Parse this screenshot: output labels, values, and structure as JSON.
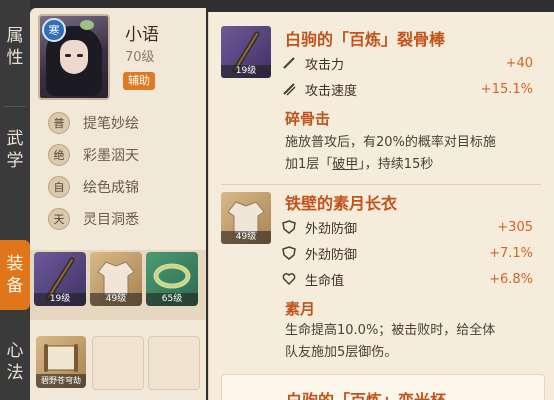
{
  "side_tabs": [
    {
      "chars": [
        "属",
        "性"
      ],
      "active": false
    },
    {
      "chars": [
        "武",
        "学"
      ],
      "active": false
    },
    {
      "chars": [
        "装",
        "备"
      ],
      "active": true
    },
    {
      "chars": [
        "心",
        "法"
      ],
      "active": false
    }
  ],
  "character": {
    "element_badge": "寒",
    "name": "小语",
    "level": "70级",
    "role": "辅助",
    "skills": [
      {
        "icon_char": "普",
        "name": "提笔妙绘"
      },
      {
        "icon_char": "绝",
        "name": "彩墨洇天"
      },
      {
        "icon_char": "自",
        "name": "绘色成锦"
      },
      {
        "icon_char": "天",
        "name": "灵目洞悉"
      }
    ]
  },
  "equipment_slots": [
    {
      "level": "19级",
      "icon": "staff-icon"
    },
    {
      "level": "49级",
      "icon": "robe-icon"
    },
    {
      "level": "65级",
      "icon": "bracelet-icon"
    }
  ],
  "manual": {
    "name": "碧野苍穹劫",
    "icon": "scroll-icon"
  },
  "detail": {
    "weapon": {
      "title": "白驹的「百炼」裂骨棒",
      "level": "19级",
      "stats": [
        {
          "icon": "sword-icon",
          "label": "攻击力",
          "value": "+40"
        },
        {
          "icon": "double-sword-icon",
          "label": "攻击速度",
          "value": "+15.1%"
        }
      ],
      "effect_title": "碎骨击",
      "effect_text_1": "施放普攻后，有20%的概率对目标施",
      "effect_text_2a": "加1层「",
      "effect_keyword": "破甲",
      "effect_text_2b": "」，持续15秒"
    },
    "armor": {
      "title": "铁壁的素月长衣",
      "level": "49级",
      "stats": [
        {
          "icon": "shield-icon",
          "label": "外劲防御",
          "value": "+305"
        },
        {
          "icon": "shield-icon",
          "label": "外劲防御",
          "value": "+7.1%"
        },
        {
          "icon": "heart-icon",
          "label": "生命值",
          "value": "+6.8%"
        }
      ],
      "effect_title": "素月",
      "effect_text_1": "生命提高10.0%；被击败时，给全体",
      "effect_text_2": "队友施加5层御伤。"
    },
    "next_item_title": "白驹的「百炼」变光杯"
  },
  "colors": {
    "accent": "#e0761c",
    "title": "#c2531a",
    "value": "#d2652a",
    "panel": "#f2e8d7"
  }
}
